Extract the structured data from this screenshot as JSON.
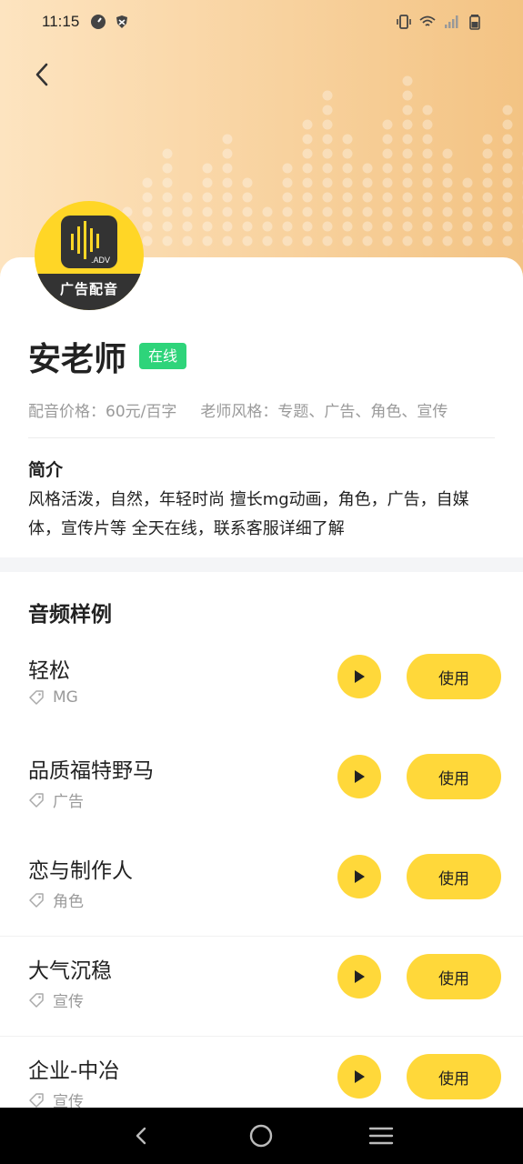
{
  "status_bar": {
    "time": "11:15",
    "left_icons": [
      "speedometer-icon",
      "shield-icon"
    ],
    "right_icons": [
      "vibrate-icon",
      "wifi-icon",
      "signal-icon",
      "battery-icon"
    ]
  },
  "header": {
    "back_icon": "back-arrow-icon",
    "gradient_colors": [
      "#fde4c0",
      "#f3c383"
    ]
  },
  "avatar": {
    "label": "广告配音",
    "logo_text": ".ADV",
    "background": "#ffd626"
  },
  "profile": {
    "name": "安老师",
    "status_badge": "在线",
    "price": "配音价格：60元/百字",
    "style": "老师风格：专题、广告、角色、宣传",
    "intro_title": "简介",
    "intro_text": "风格活泼，自然，年轻时尚  擅长mg动画，角色，广告，自媒体，宣传片等  全天在线，联系客服详细了解"
  },
  "samples_section": {
    "title": "音频样例",
    "items": [
      {
        "name": "轻松",
        "tag": "MG",
        "use_label": "使用"
      },
      {
        "name": "品质福特野马",
        "tag": "广告",
        "use_label": "使用"
      },
      {
        "name": "恋与制作人",
        "tag": "角色",
        "use_label": "使用"
      },
      {
        "name": "大气沉稳",
        "tag": "宣传",
        "use_label": "使用"
      },
      {
        "name": "企业-中冶",
        "tag": "宣传",
        "use_label": "使用"
      }
    ]
  },
  "colors": {
    "accent_yellow": "#ffd83a",
    "online_green": "#2ed47a"
  },
  "nav_bar": {
    "icons": [
      "nav-back-icon",
      "nav-home-icon",
      "nav-menu-icon"
    ]
  }
}
